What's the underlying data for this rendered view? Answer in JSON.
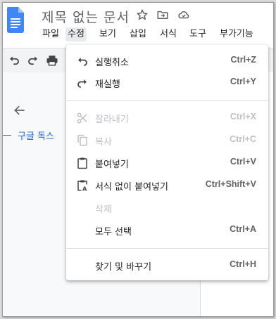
{
  "app": {
    "doc_title": "제목 없는 문서",
    "colors": {
      "accent": "#1a73e8",
      "menu_active_bg": "#e8eaed",
      "disabled": "#bdc1c6"
    }
  },
  "title_icons": [
    "star-icon",
    "move-to-folder-icon",
    "cloud-status-icon"
  ],
  "menubar": {
    "items": [
      {
        "label": "파일"
      },
      {
        "label": "수정",
        "active": true
      },
      {
        "label": "보기"
      },
      {
        "label": "삽입"
      },
      {
        "label": "서식"
      },
      {
        "label": "도구"
      },
      {
        "label": "부가기능"
      }
    ]
  },
  "toolbar": {
    "icons": [
      "undo-icon",
      "redo-icon",
      "print-icon"
    ]
  },
  "sidebar": {
    "outline_heading": "구글 독스"
  },
  "edit_menu": {
    "items": [
      {
        "label": "실행취소",
        "shortcut": "Ctrl+Z",
        "icon": "undo-icon",
        "enabled": true
      },
      {
        "label": "재실행",
        "shortcut": "Ctrl+Y",
        "icon": "redo-icon",
        "enabled": true
      },
      {
        "label": "잘라내기",
        "shortcut": "Ctrl+X",
        "icon": "cut-icon",
        "enabled": false
      },
      {
        "label": "복사",
        "shortcut": "Ctrl+C",
        "icon": "copy-icon",
        "enabled": false
      },
      {
        "label": "붙여넣기",
        "shortcut": "Ctrl+V",
        "icon": "paste-icon",
        "enabled": true
      },
      {
        "label": "서식 없이 붙여넣기",
        "shortcut": "Ctrl+Shift+V",
        "icon": "paste-plain-icon",
        "enabled": true
      },
      {
        "label": "삭제",
        "shortcut": "",
        "icon": "",
        "enabled": false
      },
      {
        "label": "모두 선택",
        "shortcut": "Ctrl+A",
        "icon": "",
        "enabled": true
      },
      {
        "label": "찾기 및 바꾸기",
        "shortcut": "Ctrl+H",
        "icon": "",
        "enabled": true
      }
    ]
  }
}
